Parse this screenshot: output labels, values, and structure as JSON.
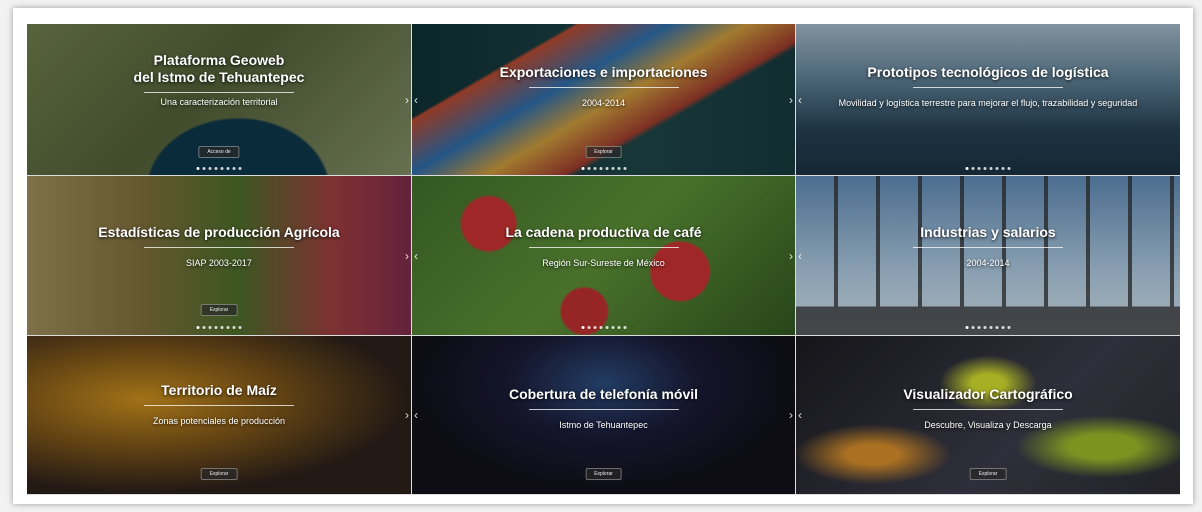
{
  "tiles": [
    {
      "title": "Plataforma Geoweb\ndel Istmo de Tehuantepec",
      "subtitle": "Una caracterización territorial",
      "button": "Acceso de",
      "colors": [
        "#6c7a4a",
        "#4f5d36",
        "#7d8a63"
      ]
    },
    {
      "title": "Exportaciones e importaciones",
      "subtitle": "2004-2014",
      "button": "Explorar",
      "colors": [
        "#0f2f33",
        "#1d4346",
        "#b8452d"
      ]
    },
    {
      "title": "Prototipos tecnológicos de logística",
      "subtitle": "Movilidad y logística terrestre para mejorar el flujo, trazabilidad y seguridad",
      "button": "",
      "colors": [
        "#243f52",
        "#5f7f94",
        "#9fb4c1"
      ]
    },
    {
      "title": "Estadísticas de producción Agrícola",
      "subtitle": "SIAP 2003-2017",
      "button": "Explorar",
      "colors": [
        "#7b6b3a",
        "#4b6a2a",
        "#9a3c3d"
      ]
    },
    {
      "title": "La cadena productiva de café",
      "subtitle": "Región Sur-Sureste de México",
      "button": "",
      "colors": [
        "#3f6b2a",
        "#b82f2f",
        "#5a8a35"
      ]
    },
    {
      "title": "Industrias y salarios",
      "subtitle": "2004-2014",
      "button": "",
      "colors": [
        "#6d8fb0",
        "#a8c3d8",
        "#2b2b2b"
      ]
    },
    {
      "title": "Territorio de Maíz",
      "subtitle": "Zonas potenciales de producción",
      "button": "Explorar",
      "colors": [
        "#2a1f1a",
        "#c58b1d",
        "#5b3a20"
      ]
    },
    {
      "title": "Cobertura de telefonía móvil",
      "subtitle": "Istmo de Tehuantepec",
      "button": "Explorar",
      "colors": [
        "#101018",
        "#2a2a4a",
        "#5a2a6a"
      ]
    },
    {
      "title": "Visualizador Cartográfico",
      "subtitle": "Descubre, Visualiza y Descarga",
      "button": "Explorar",
      "colors": [
        "#1a1a1f",
        "#3a3a48",
        "#cbd52d"
      ]
    }
  ],
  "nav": {
    "prev": "‹",
    "next": "›"
  }
}
